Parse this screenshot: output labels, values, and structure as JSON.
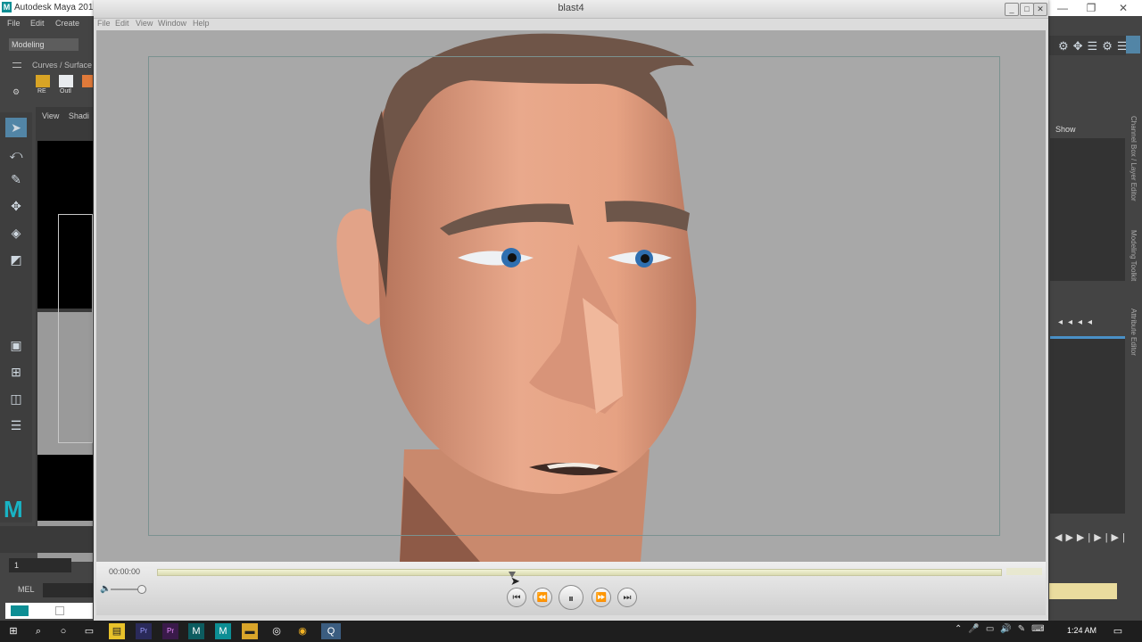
{
  "maya": {
    "title": "Autodesk Maya 201",
    "menus": [
      "File",
      "Edit",
      "Create"
    ],
    "workspace": "Modeling",
    "shelf_tab": "Curves / Surface",
    "shelf_labels": [
      "RE",
      "Outl"
    ],
    "view_menu": [
      "View",
      "Shadi"
    ],
    "frame_field": "1",
    "mel_label": "MEL",
    "right_show_label": "Show",
    "right_vtabs": [
      "Channel Box / Layer Editor",
      "Modeling Toolkit",
      "Attribute Editor"
    ]
  },
  "blast": {
    "title": "blast4",
    "menus": [
      "File",
      "Edit",
      "View",
      "Window",
      "Help"
    ],
    "timecode": "00:00:00",
    "progress": 0.42,
    "controls": {
      "prev": "⏮",
      "rewind": "⏪",
      "pause": "⏸",
      "forward": "⏩",
      "next": "⏭"
    }
  },
  "taskbar": {
    "time": "1:24 AM",
    "apps": [
      "start-icon",
      "search-icon",
      "cortana-icon",
      "task-view-icon",
      "file-icon",
      "premiere-icon",
      "premiere-rush-icon",
      "maya-icon",
      "maya-icon-2",
      "folder-icon",
      "obs-icon",
      "chrome-icon",
      "quicktime-icon"
    ]
  },
  "colors": {
    "maya_bg": "#444444",
    "viewport_bg": "#a8a8a8",
    "accent": "#4a90c6",
    "maya_logo": "#19b3c4",
    "taskbar": "#1e1e1e"
  }
}
